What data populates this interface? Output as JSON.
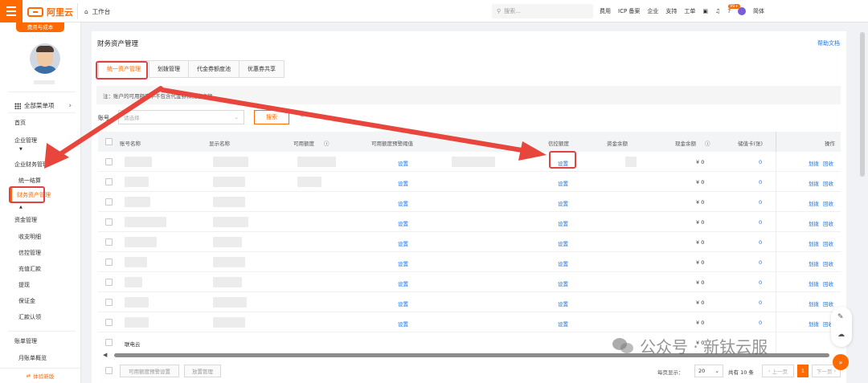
{
  "topbar": {
    "brand": "阿里云",
    "workspace_tab": "工作台",
    "search_placeholder": "搜索...",
    "links": [
      "费用",
      "ICP 备案",
      "企业",
      "支持",
      "工单"
    ],
    "notification_count": "99+",
    "language": "简体"
  },
  "sidebar": {
    "tag": "费用与成本",
    "all_products": "全部菜单项",
    "items": [
      {
        "label": "首页",
        "sub": false
      },
      {
        "label": "企业管理",
        "sub": false
      },
      {
        "label": "企业财务管理",
        "sub": false
      },
      {
        "label": "统一结算",
        "sub": true
      },
      {
        "label": "财务资产管理",
        "sub": true,
        "active": true
      },
      {
        "label": "资金管理",
        "sub": false
      },
      {
        "label": "收支明细",
        "sub": true
      },
      {
        "label": "信控管理",
        "sub": true
      },
      {
        "label": "充值汇款",
        "sub": true
      },
      {
        "label": "提现",
        "sub": true
      },
      {
        "label": "保证金",
        "sub": true
      },
      {
        "label": "汇款认领",
        "sub": true
      },
      {
        "label": "账单管理",
        "sub": false
      },
      {
        "label": "月账单概览",
        "sub": true
      }
    ],
    "bottom_label": "体验新版"
  },
  "main": {
    "title": "财务资产管理",
    "help": "帮助文档",
    "tabs": [
      "统一资产管理",
      "划拨管理",
      "代金券额度池",
      "优惠券共享"
    ],
    "active_tab": 0,
    "notice": "注：账户的可用额度中不包含代金券和优惠卡额",
    "account_label": "账号",
    "account_placeholder": "请选择",
    "search_button": "搜索"
  },
  "table": {
    "columns": [
      "账号名称",
      "显示名称",
      "可用额度",
      "可用额度预警阈值",
      "信控额度",
      "资金余额",
      "现金余额",
      "储值卡(张)",
      "操作"
    ],
    "rows": [
      {
        "name": "",
        "threshold_link": "设置",
        "credit_link": "设置",
        "cash": "¥ 0",
        "cards": "0",
        "op1": "划拨",
        "op2": "回收"
      },
      {
        "name": "",
        "threshold_link": "设置",
        "credit_link": "设置",
        "cash": "¥ 0",
        "cards": "0",
        "op1": "划拨",
        "op2": "回收"
      },
      {
        "name": "",
        "threshold_link": "设置",
        "credit_link": "设置",
        "cash": "¥ 0",
        "cards": "0",
        "op1": "划拨",
        "op2": "回收"
      },
      {
        "name": "",
        "threshold_link": "设置",
        "credit_link": "设置",
        "cash": "¥ 0",
        "cards": "0",
        "op1": "划拨",
        "op2": "回收"
      },
      {
        "name": "",
        "threshold_link": "设置",
        "credit_link": "设置",
        "cash": "¥ 0",
        "cards": "0",
        "op1": "划拨",
        "op2": "回收"
      },
      {
        "name": "",
        "threshold_link": "设置",
        "credit_link": "设置",
        "cash": "¥ 0",
        "cards": "0",
        "op1": "划拨",
        "op2": "回收"
      },
      {
        "name": "",
        "threshold_link": "设置",
        "credit_link": "设置",
        "cash": "¥ 0",
        "cards": "0",
        "op1": "划拨",
        "op2": "回收"
      },
      {
        "name": "",
        "threshold_link": "设置",
        "credit_link": "设置",
        "cash": "¥ 0",
        "cards": "0",
        "op1": "划拨",
        "op2": "回收"
      },
      {
        "name": "",
        "threshold_link": "设置",
        "credit_link": "设置",
        "cash": "¥ 0",
        "cards": "0",
        "op1": "划拨",
        "op2": "回收"
      },
      {
        "name": "联电云",
        "threshold_link": "设置",
        "credit_link": "设置",
        "cash": "¥ 0",
        "cards": "0",
        "op1": "划拨",
        "op2": "回收"
      }
    ]
  },
  "footer": {
    "btn_threshold": "可用额度预警设置",
    "btn_placeholder": "放置管理",
    "page_size_label": "每页显示：",
    "page_size": "20",
    "total": "共有 10 条",
    "prev": "上一页",
    "current_page": "1",
    "next": "下一页"
  },
  "watermark": "公众号 · 新钛云服",
  "colors": {
    "brand": "#ff6a00",
    "link": "#1a73e8",
    "annotation": "#e04242"
  }
}
